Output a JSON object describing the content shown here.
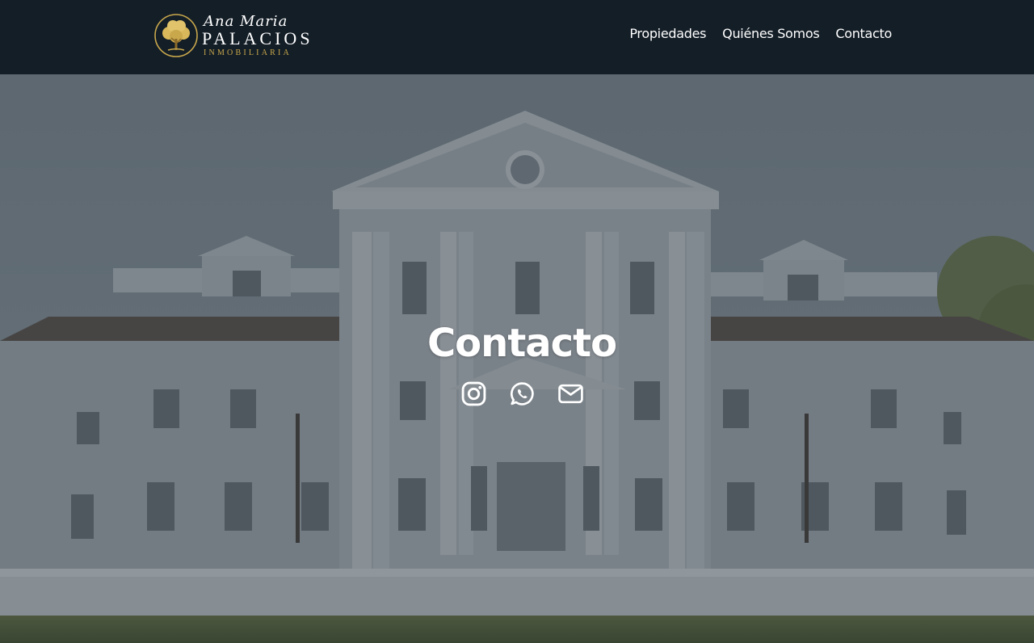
{
  "header": {
    "logo": {
      "script": "Ana Maria",
      "name": "PALACIOS",
      "sub": "INMOBILIARIA",
      "gold_color": "#c9a84c"
    },
    "nav": [
      {
        "label": "Propiedades"
      },
      {
        "label": "Quiénes Somos"
      },
      {
        "label": "Contacto"
      }
    ],
    "background_color": "#141e27"
  },
  "hero": {
    "title": "Contacto",
    "social_links": [
      {
        "icon": "instagram-icon",
        "label": "Instagram"
      },
      {
        "icon": "whatsapp-icon",
        "label": "WhatsApp"
      },
      {
        "icon": "email-icon",
        "label": "Email"
      }
    ],
    "overlay_color": "#3c4650"
  }
}
